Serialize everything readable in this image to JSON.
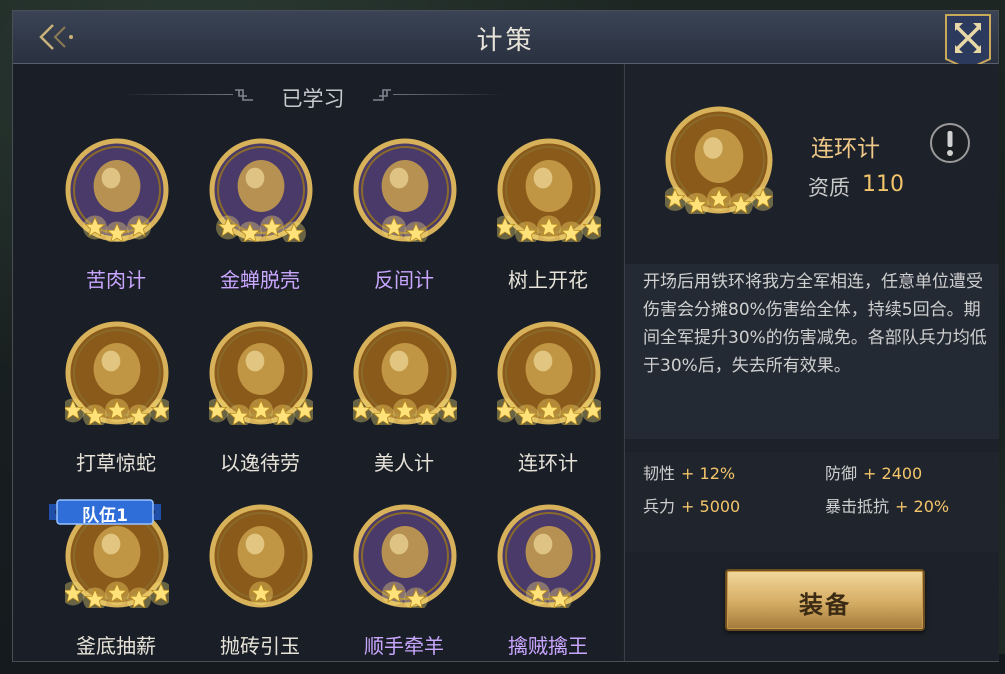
{
  "window": {
    "title": "计策"
  },
  "learned_section": {
    "label": "已学习"
  },
  "skills": [
    {
      "name": "苦肉计",
      "stars": 3,
      "color": "purple",
      "icon": "warrior-icon",
      "bg": "#4a3a6a"
    },
    {
      "name": "金蝉脱壳",
      "stars": 4,
      "color": "purple",
      "icon": "cicada-icon",
      "bg": "#4a3a6a"
    },
    {
      "name": "反间计",
      "stars": 2,
      "color": "purple",
      "icon": "scholar-icon",
      "bg": "#4a3a6a"
    },
    {
      "name": "树上开花",
      "stars": 5,
      "color": "white",
      "icon": "lotus-icon",
      "bg": "#8a5a1a"
    },
    {
      "name": "打草惊蛇",
      "stars": 5,
      "color": "white",
      "icon": "snake-icon",
      "bg": "#8a5a1a"
    },
    {
      "name": "以逸待劳",
      "stars": 5,
      "color": "white",
      "icon": "armor-icon",
      "bg": "#8a5a1a"
    },
    {
      "name": "美人计",
      "stars": 5,
      "color": "white",
      "icon": "beauty-icon",
      "bg": "#8a5a1a"
    },
    {
      "name": "连环计",
      "stars": 5,
      "color": "white",
      "icon": "chain-icon",
      "bg": "#8a5a1a"
    },
    {
      "name": "釜底抽薪",
      "stars": 5,
      "color": "white",
      "icon": "cauldron-icon",
      "bg": "#8a5a1a",
      "badge": "队伍1"
    },
    {
      "name": "抛砖引玉",
      "stars": 1,
      "color": "white",
      "icon": "brick-icon",
      "bg": "#8a5a1a"
    },
    {
      "name": "顺手牵羊",
      "stars": 2,
      "color": "purple",
      "icon": "goat-icon",
      "bg": "#4a3a6a"
    },
    {
      "name": "擒贼擒王",
      "stars": 2,
      "color": "purple",
      "icon": "king-icon",
      "bg": "#4a3a6a"
    }
  ],
  "detail": {
    "name": "连环计",
    "quality_label": "资质",
    "quality_value": "110",
    "stars": 5,
    "icon": "chain-icon",
    "description": "开场后用铁环将我方全军相连，任意单位遭受伤害会分摊80%伤害给全体，持续5回合。期间全军提升30%的伤害减免。各部队兵力均低于30%后，失去所有效果。",
    "stats": [
      {
        "label": "韧性",
        "value": "+ 12%"
      },
      {
        "label": "防御",
        "value": "+ 2400"
      },
      {
        "label": "兵力",
        "value": "+ 5000"
      },
      {
        "label": "暴击抵抗",
        "value": "+ 20%"
      }
    ],
    "equip_label": "装备"
  },
  "colors": {
    "gold": "#d7b25a",
    "accent_text": "#f3c46a",
    "purple_text": "#c9a6ff"
  }
}
